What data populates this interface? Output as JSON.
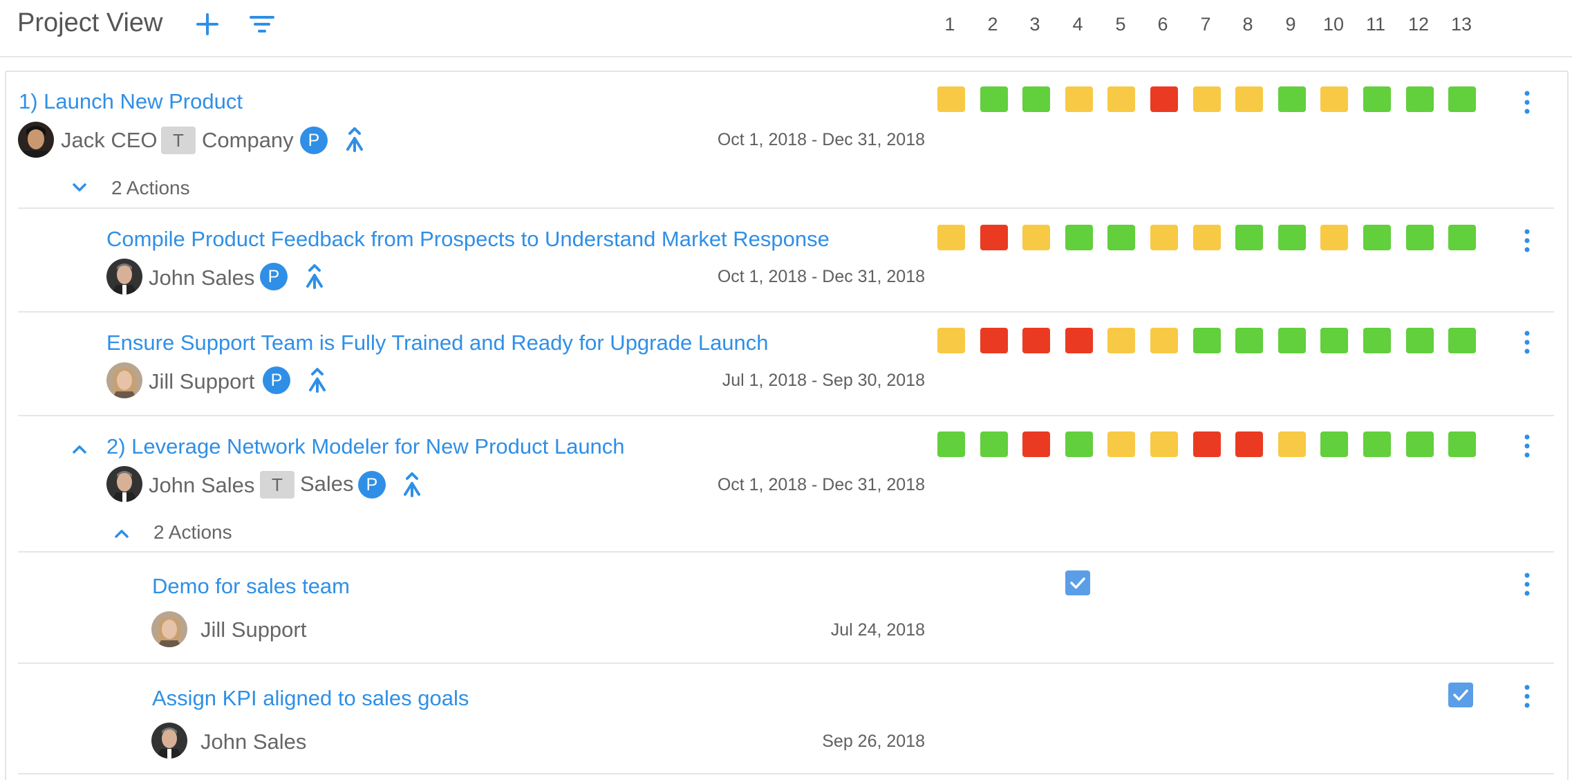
{
  "header": {
    "title": "Project View",
    "weeks": [
      "1",
      "2",
      "3",
      "4",
      "5",
      "6",
      "7",
      "8",
      "9",
      "10",
      "11",
      "12",
      "13"
    ]
  },
  "colors": {
    "accent": "#2f8fe6",
    "green": "#62cf3c",
    "yellow": "#f8c944",
    "red": "#ea3b22"
  },
  "rows": [
    {
      "title": "1) Launch New Product",
      "owner": "Jack CEO",
      "team_badge": "T",
      "team": "Company",
      "priority_badge": "P",
      "date": "Oct 1, 2018 - Dec 31, 2018",
      "actions_label": "2 Actions",
      "status": [
        "yellow",
        "green",
        "green",
        "yellow",
        "yellow",
        "red",
        "yellow",
        "yellow",
        "green",
        "yellow",
        "green",
        "green",
        "green"
      ]
    },
    {
      "title": "Compile Product Feedback from Prospects to Understand Market Response",
      "owner": "John Sales",
      "priority_badge": "P",
      "date": "Oct 1, 2018 - Dec 31, 2018",
      "status": [
        "yellow",
        "red",
        "yellow",
        "green",
        "green",
        "yellow",
        "yellow",
        "green",
        "green",
        "yellow",
        "green",
        "green",
        "green"
      ]
    },
    {
      "title": "Ensure Support Team is Fully Trained and Ready for Upgrade Launch",
      "owner": "Jill Support",
      "priority_badge": "P",
      "date": "Jul 1, 2018 - Sep 30, 2018",
      "status": [
        "yellow",
        "red",
        "red",
        "red",
        "yellow",
        "yellow",
        "green",
        "green",
        "green",
        "green",
        "green",
        "green",
        "green"
      ]
    },
    {
      "title": "2) Leverage Network Modeler for New Product Launch",
      "owner": "John Sales",
      "team_badge": "T",
      "team": "Sales",
      "priority_badge": "P",
      "date": "Oct 1, 2018 - Dec 31, 2018",
      "actions_label": "2 Actions",
      "status": [
        "green",
        "green",
        "red",
        "green",
        "yellow",
        "yellow",
        "red",
        "red",
        "yellow",
        "green",
        "green",
        "green",
        "green"
      ]
    },
    {
      "title": "Demo for sales team",
      "owner": "Jill Support",
      "date": "Jul 24, 2018",
      "checked_week": 4
    },
    {
      "title": "Assign KPI aligned to sales goals",
      "owner": "John Sales",
      "date": "Sep 26, 2018",
      "checked_week": 13
    }
  ]
}
